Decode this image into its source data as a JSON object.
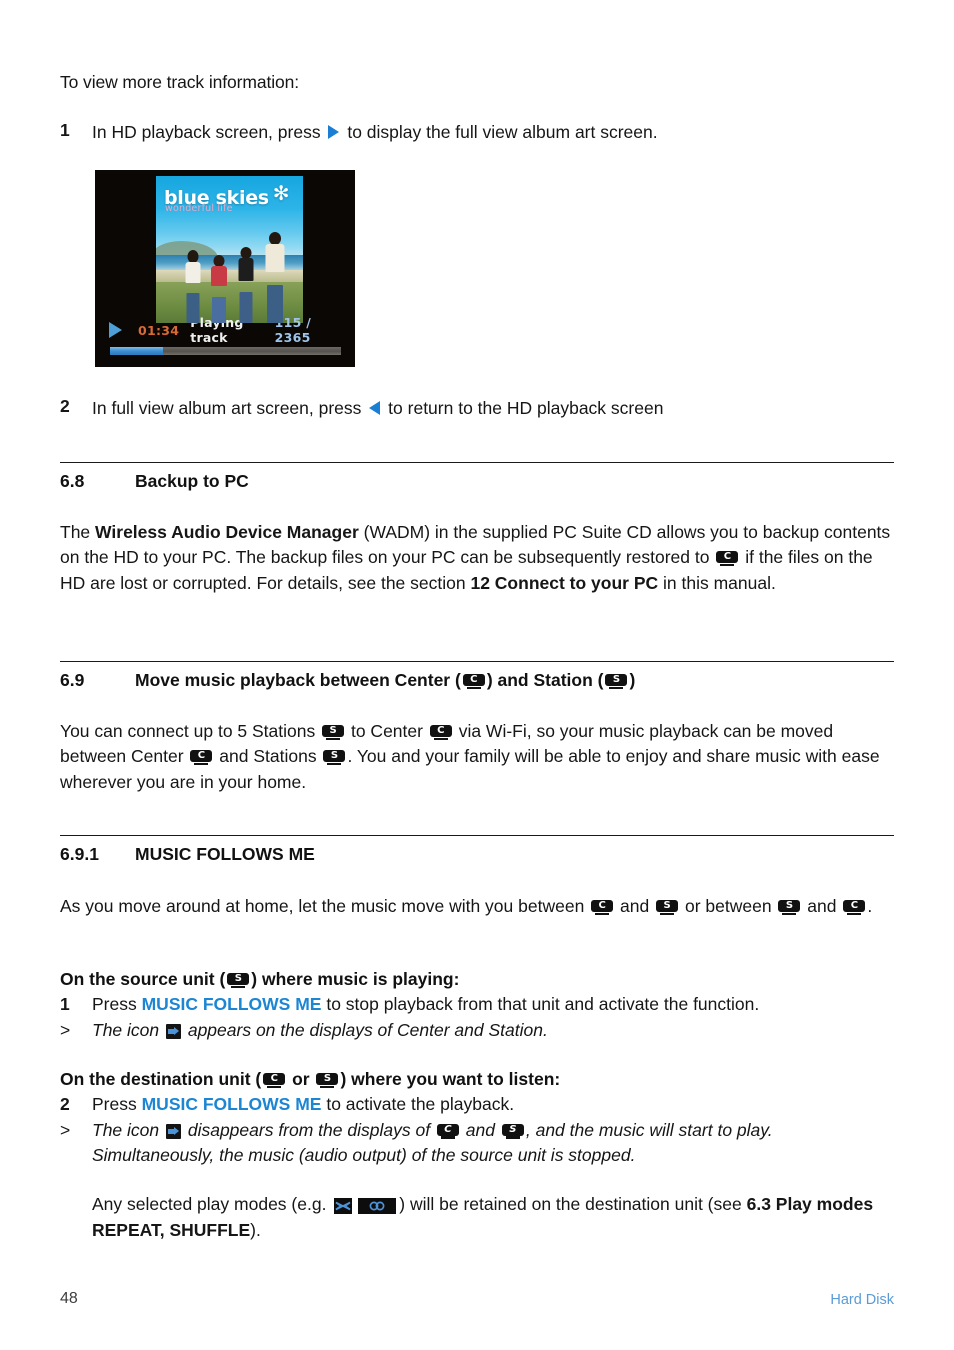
{
  "intro": {
    "line": "To view more track information:"
  },
  "steps": {
    "step1": {
      "number": "1",
      "text_before": "In HD playback screen, press",
      "text_after": "to display the full view album art screen.",
      "arrow_icon": "triangle-right-icon"
    },
    "step2": {
      "number": "2",
      "text_before": "In full view album art screen, press",
      "text_after": "to return to the HD playback screen",
      "arrow_icon": "triangle-left-icon"
    }
  },
  "lcd": {
    "album_title": "blue skies",
    "album_title_star": "✻",
    "album_subtitle": "wonderful life",
    "play_icon": "play-triangle-icon",
    "elapsed_time": "01:34",
    "state_label": "Playing track",
    "track_count": "115 / 2365",
    "progress_percent": 23,
    "colors": {
      "background": "#0a0705",
      "time": "#d96a35",
      "state": "#f0f0f0",
      "count": "#9fc4e8",
      "progress_fill": "#3d8fd1"
    }
  },
  "section_6_8": {
    "number": "6.8",
    "title": "Backup to PC",
    "para": {
      "p1": "The ",
      "bold1": "Wireless Audio Device Manager",
      "p2": " (WADM) in the supplied PC Suite CD allows you to backup contents on the HD to your PC. The backup files on your PC can be subsequently restored to ",
      "p3": " if the files on the HD are lost or corrupted. For details, see the section ",
      "bold2": "12 Connect to your PC",
      "p4": " in this manual."
    }
  },
  "section_6_9": {
    "number": "6.9",
    "title_part1": "Move music playback between Center (",
    "title_part2": ") and Station (",
    "title_part3": ")",
    "para": {
      "p1": "You can connect up to 5 Stations ",
      "p2": " to Center ",
      "p3": " via Wi-Fi, so your music playback can be moved between Center ",
      "p4": " and Stations ",
      "p5": ". You and your family will be able to enjoy and share music with ease wherever you are in your home."
    }
  },
  "section_6_9_1": {
    "number": "6.9.1",
    "title": "MUSIC FOLLOWS ME",
    "para": {
      "p1": "As you move around at home, let the music move with you between ",
      "p2": " and ",
      "p3": " or between ",
      "p4": " and ",
      "p5": "."
    },
    "source_block": {
      "heading_p1": "On the source unit (",
      "heading_p2": ") where music is playing:",
      "step_number": "1",
      "step_before": "Press ",
      "step_highlight": "MUSIC FOLLOWS ME",
      "step_after": " to stop playback from that unit and activate the function.",
      "note_marker": ">",
      "note_before": "The icon ",
      "note_after": " appears on the displays of Center and Station."
    },
    "dest_block": {
      "heading_p1": "On the destination unit (",
      "heading_p2": " or ",
      "heading_p3": ") where you want to listen:",
      "step_number": "2",
      "step_before": "Press ",
      "step_highlight": "MUSIC FOLLOWS ME",
      "step_after": " to activate the playback.",
      "note_marker": ">",
      "note_p1": "The icon ",
      "note_p2": " disappears from the displays of ",
      "note_p3": " and ",
      "note_p4": ", and the music will start to play. Simultaneously, the music (audio output) of the source unit is stopped."
    },
    "playmodes_para": {
      "p1": "Any selected play modes (e.g. ",
      "p2": ") will be retained on the destination unit (see ",
      "bold1": "6.3 Play modes REPEAT, SHUFFLE",
      "p3": ")."
    }
  },
  "badges": {
    "center_label": "C",
    "station_label": "S"
  },
  "icons": {
    "music_follows_me": "arrow-right-icon",
    "shuffle": "shuffle-icon",
    "repeat": "repeat-icon"
  },
  "footer": {
    "page_number": "48",
    "section_label": "Hard Disk",
    "section_label_color": "#5b9bd5"
  }
}
